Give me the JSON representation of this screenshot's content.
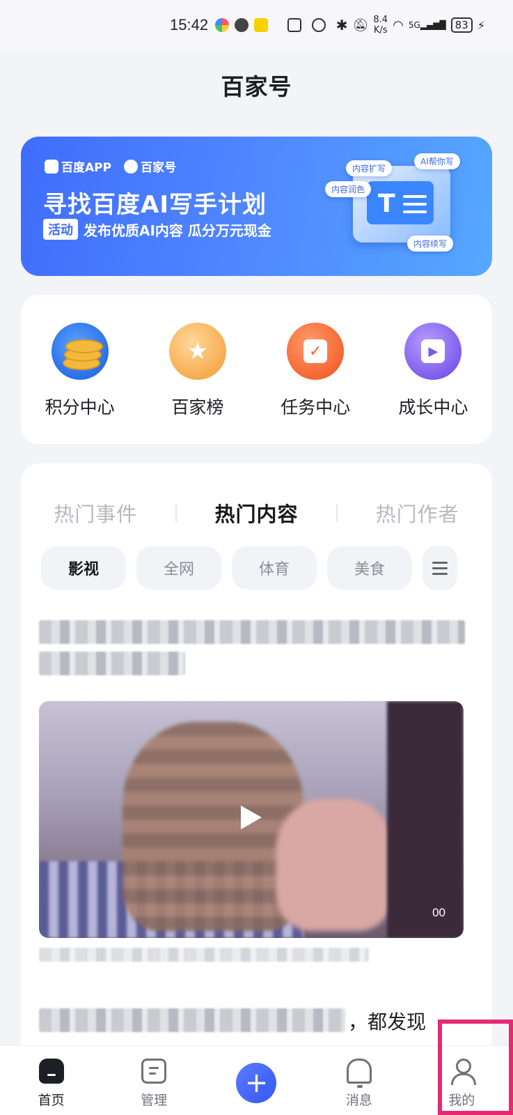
{
  "status_bar": {
    "time": "15:42",
    "net_speed_value": "8.4",
    "net_speed_unit": "K/s",
    "signal": "5G",
    "battery": "83"
  },
  "header": {
    "title": "百家号"
  },
  "banner": {
    "logo_app": "百度APP",
    "logo_bjh": "百家号",
    "title": "寻找百度AI写手计划",
    "tag": "活动",
    "subtitle": "发布优质AI内容 瓜分万元现金",
    "pills": [
      "AI帮你写",
      "内容扩写",
      "内容润色",
      "内容续写"
    ]
  },
  "tools": [
    {
      "label": "积分中心",
      "icon": "coins-icon"
    },
    {
      "label": "百家榜",
      "icon": "trophy-icon"
    },
    {
      "label": "任务中心",
      "icon": "task-icon"
    },
    {
      "label": "成长中心",
      "icon": "growth-icon"
    }
  ],
  "hot_tabs": [
    {
      "label": "热门事件",
      "active": false
    },
    {
      "label": "热门内容",
      "active": true
    },
    {
      "label": "热门作者",
      "active": false
    }
  ],
  "chips": [
    {
      "label": "影视",
      "active": true
    },
    {
      "label": "全网",
      "active": false
    },
    {
      "label": "体育",
      "active": false
    },
    {
      "label": "美食",
      "active": false
    }
  ],
  "feed": {
    "video_duration": "00",
    "tail_text": "，都发现"
  },
  "bottom_nav": [
    {
      "label": "首页",
      "icon": "home-icon",
      "active": true
    },
    {
      "label": "管理",
      "icon": "manage-icon",
      "active": false
    },
    {
      "label": "",
      "icon": "publish-plus-icon",
      "active": false
    },
    {
      "label": "消息",
      "icon": "bell-icon",
      "active": false
    },
    {
      "label": "我的",
      "icon": "user-icon",
      "active": false
    }
  ],
  "colors": {
    "accent": "#3b6cf5",
    "highlight": "#e52a73"
  }
}
